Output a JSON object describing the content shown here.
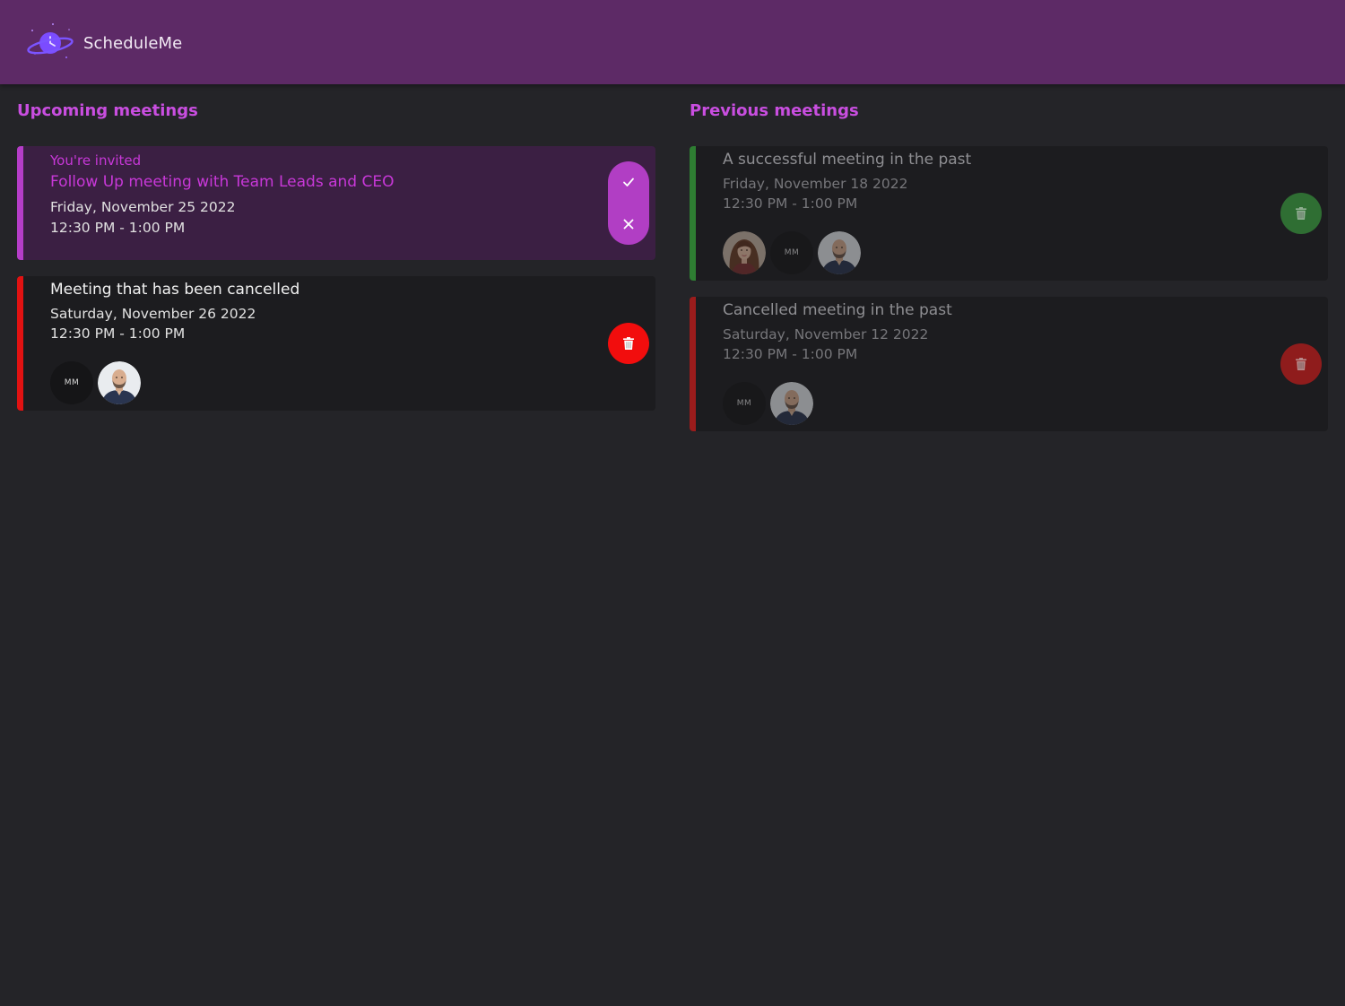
{
  "app": {
    "name": "ScheduleMe",
    "logo_icon": "planet-clock-logo-icon"
  },
  "colors": {
    "header_bg": "#5d2a66",
    "page_bg": "#242428",
    "accent": "#c94ee0",
    "invite": "#c838d8",
    "cancelled": "#e01212",
    "success": "#2e7d32"
  },
  "upcoming": {
    "title": "Upcoming meetings",
    "meetings": [
      {
        "status": "invited",
        "label": "You're invited",
        "title": "Follow Up meeting with Team Leads and CEO",
        "date": "Friday, November 25 2022",
        "time": "12:30 PM - 1:00 PM",
        "actions": [
          "accept-check-icon",
          "decline-x-icon"
        ]
      },
      {
        "status": "cancelled",
        "title": "Meeting that has been cancelled",
        "date": "Saturday, November 26 2022",
        "time": "12:30 PM - 1:00 PM",
        "attendees": [
          {
            "type": "initials",
            "initials": "MM"
          },
          {
            "type": "photo",
            "icon": "man-avatar-icon"
          }
        ],
        "action": "trash-icon"
      }
    ]
  },
  "previous": {
    "title": "Previous meetings",
    "meetings": [
      {
        "status": "completed",
        "title": "A successful meeting in the past",
        "date": "Friday, November 18 2022",
        "time": "12:30 PM - 1:00 PM",
        "attendees": [
          {
            "type": "photo",
            "icon": "woman-avatar-icon"
          },
          {
            "type": "initials",
            "initials": "MM"
          },
          {
            "type": "photo",
            "icon": "man-avatar-icon"
          }
        ],
        "action": "trash-icon"
      },
      {
        "status": "cancelled",
        "title": "Cancelled meeting in the past",
        "date": "Saturday, November 12 2022",
        "time": "12:30 PM - 1:00 PM",
        "attendees": [
          {
            "type": "initials",
            "initials": "MM"
          },
          {
            "type": "photo",
            "icon": "man-avatar-icon"
          }
        ],
        "action": "trash-icon"
      }
    ]
  }
}
